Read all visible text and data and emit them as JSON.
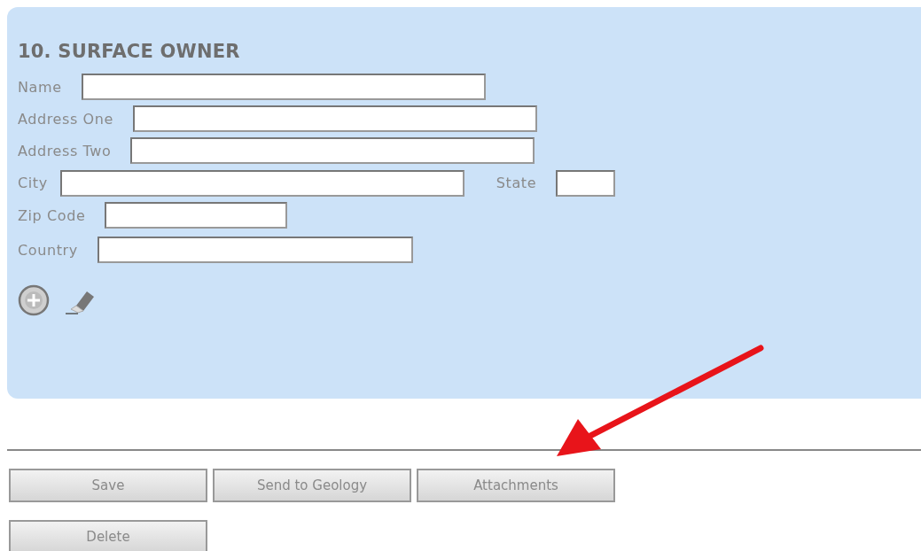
{
  "section": {
    "title": "10. SURFACE OWNER",
    "rows": [
      {
        "fields": [
          {
            "label": "Name"
          }
        ]
      },
      {
        "fields": [
          {
            "label": "Address One"
          }
        ]
      },
      {
        "fields": [
          {
            "label": "Address Two"
          }
        ]
      },
      {
        "fields": [
          {
            "label": "City"
          },
          {
            "label": "State"
          }
        ]
      },
      {
        "fields": [
          {
            "label": "Zip Code"
          }
        ]
      },
      {
        "fields": [
          {
            "label": "Country"
          }
        ]
      }
    ]
  },
  "buttons": [
    [
      "Save",
      "Send to Geology",
      "Attachments"
    ],
    [
      "Delete"
    ]
  ]
}
